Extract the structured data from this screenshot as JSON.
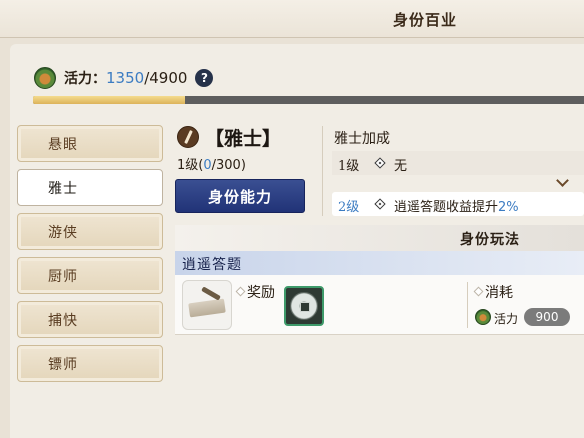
{
  "window": {
    "title": "身份百业"
  },
  "vitality": {
    "icon": "vitality-gourd-icon",
    "label": "活力：",
    "current": "1350",
    "max": "/4900",
    "help": "?",
    "fill_fraction": 0.2755
  },
  "sidebar": {
    "items": [
      {
        "label": "悬眼"
      },
      {
        "label": "雅士"
      },
      {
        "label": "游侠"
      },
      {
        "label": "厨师"
      },
      {
        "label": "捕快"
      },
      {
        "label": "镖师"
      }
    ],
    "active_index": 1
  },
  "identity": {
    "icon": "brush-icon",
    "name": "【雅士】",
    "level_prefix": "1级(",
    "level_current": "0",
    "level_suffix": "/300)",
    "ability_button": "身份能力"
  },
  "bonus": {
    "title": "雅士加成",
    "row1": {
      "level": "1级",
      "text": "无"
    },
    "row2": {
      "level": "2级",
      "text": "逍遥答题收益提升",
      "percent": "2%"
    }
  },
  "play": {
    "title": "身份玩法",
    "task": {
      "name": "逍遥答题",
      "reward_label": "奖励",
      "cost_label": "消耗",
      "cost_name": "活力",
      "cost_value": "900"
    }
  },
  "colors": {
    "accent_blue": "#3c7cc2",
    "ability_button": "#2b3d85",
    "vitality_fill": "#e3c06a"
  }
}
